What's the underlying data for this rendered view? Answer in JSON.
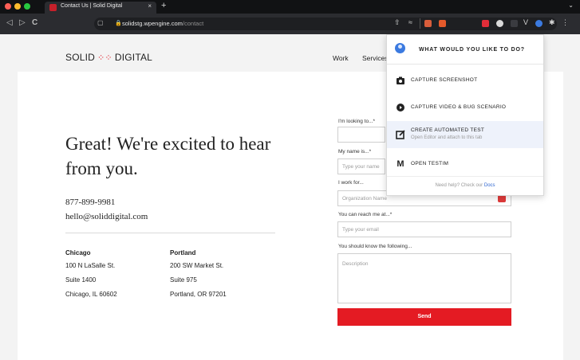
{
  "browser": {
    "tab_title": "Contact Us | Solid Digital",
    "tab_close": "×",
    "new_tab": "+",
    "url_host": "solidstg.wpengine.com",
    "url_path": "/contact",
    "nav_back": "◁",
    "nav_forward": "▷",
    "nav_reload": "C"
  },
  "site": {
    "logo_left": "SOLID",
    "logo_right": "DIGITAL",
    "nav": {
      "work": "Work",
      "services": "Services"
    },
    "headline": "Great! We're excited to hear from you.",
    "phone": "877-899-9981",
    "email": "hello@soliddigital.com",
    "offices": [
      {
        "city": "Chicago",
        "line1": "100 N LaSalle St.",
        "line2": "Suite 1400",
        "line3": "Chicago, IL 60602"
      },
      {
        "city": "Portland",
        "line1": "200 SW Market St.",
        "line2": "Suite 975",
        "line3": "Portland, OR 97201"
      }
    ],
    "form": {
      "looking_label": "I'm looking to...*",
      "name_label": "My name is...*",
      "name_placeholder": "Type your name",
      "work_label": "I work for...",
      "org_placeholder": "Organization Name",
      "reach_label": "You can reach me at...*",
      "email_placeholder": "Type your email",
      "know_label": "You should know the following...",
      "desc_placeholder": "Description",
      "send_label": "Send"
    }
  },
  "popup": {
    "title": "WHAT WOULD YOU LIKE TO DO?",
    "items": [
      {
        "label": "CAPTURE SCREENSHOT",
        "icon": "camera-icon"
      },
      {
        "label": "CAPTURE VIDEO & BUG SCENARIO",
        "icon": "record-icon"
      },
      {
        "label": "CREATE AUTOMATED TEST",
        "sub": "Open Editor and attach to this tab",
        "icon": "edit-icon"
      },
      {
        "label": "OPEN TESTIM",
        "icon": "testim-logo-icon"
      }
    ],
    "help_text": "Need help? Check our",
    "help_link": "Docs"
  },
  "colors": {
    "brand_red": "#e41b23",
    "popup_highlight": "#eef2fb",
    "link_blue": "#2f66d0"
  }
}
